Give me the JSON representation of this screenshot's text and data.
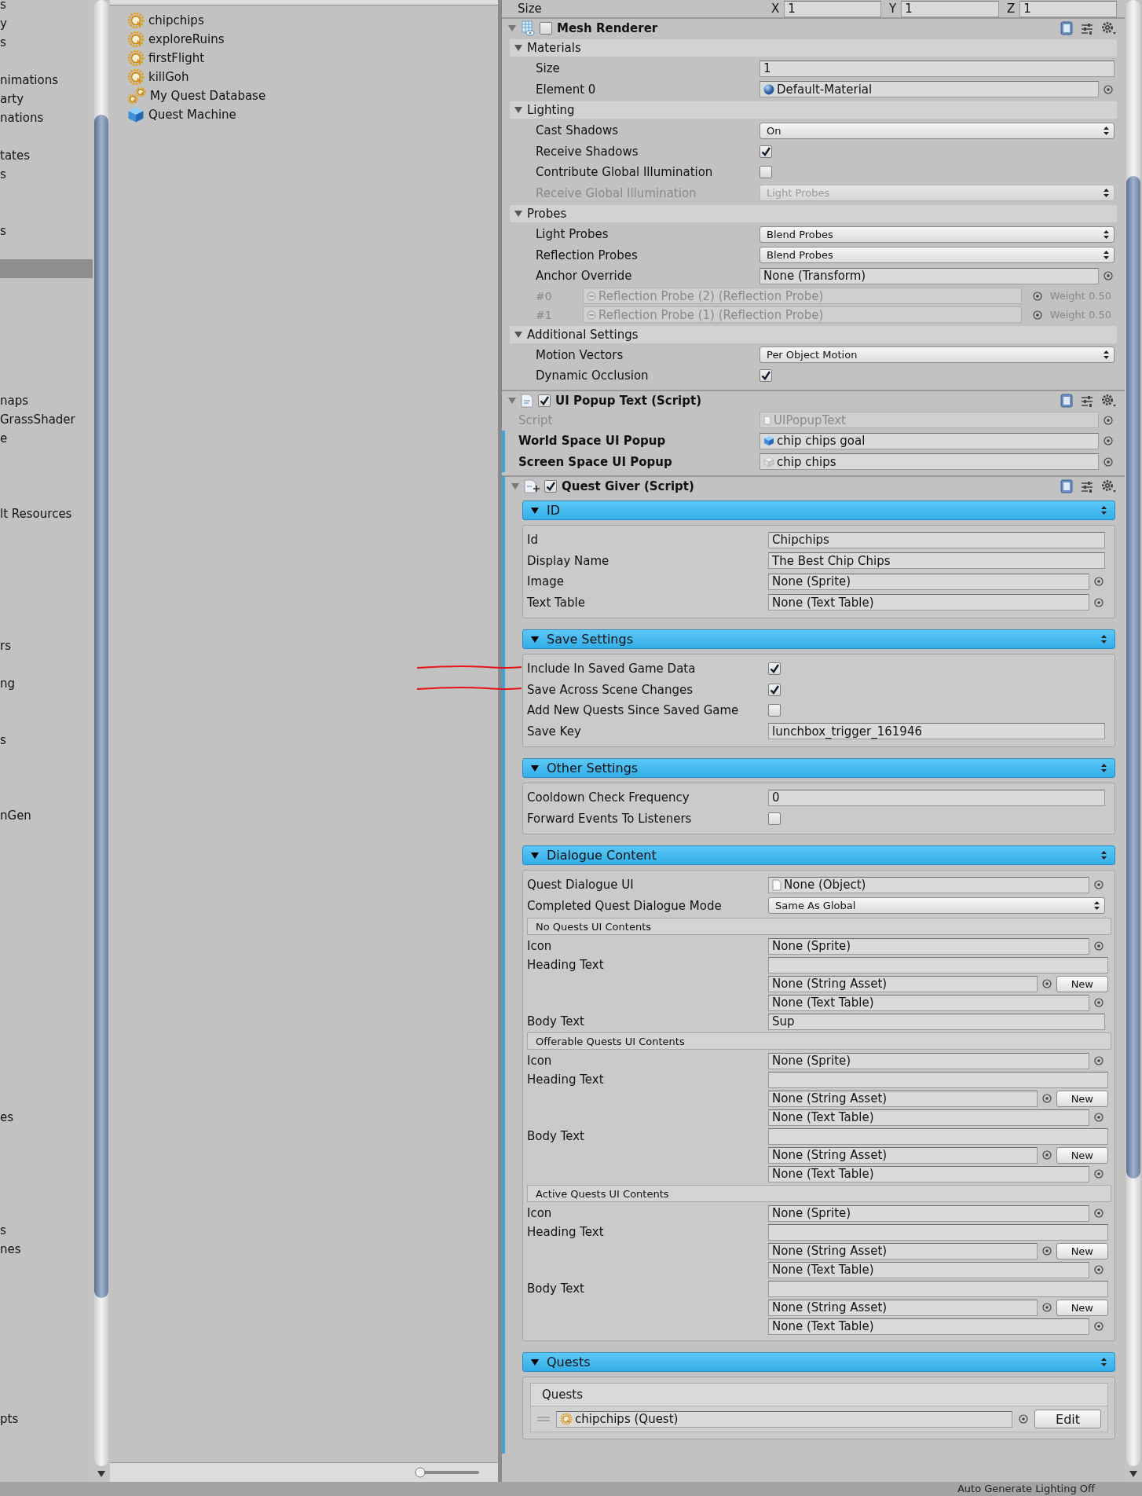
{
  "hierarchy": {
    "rows": [
      {
        "text": "s",
        "selected": false
      },
      {
        "text": "y",
        "selected": false
      },
      {
        "text": "s",
        "selected": false
      },
      {
        "selected": false
      },
      {
        "text": "nimations",
        "selected": false
      },
      {
        "text": "arty",
        "selected": false
      },
      {
        "text": "nations",
        "selected": false
      },
      {
        "selected": false
      },
      {
        "text": "tates",
        "selected": false
      },
      {
        "text": "s",
        "selected": false
      },
      {
        "selected": false
      },
      {
        "selected": false
      },
      {
        "text": "s",
        "selected": false
      },
      {
        "selected": false
      },
      {
        "selected": true
      },
      {
        "selected": false
      },
      {
        "selected": false
      },
      {
        "selected": false
      },
      {
        "selected": false
      },
      {
        "selected": false
      },
      {
        "selected": false
      },
      {
        "text": "naps",
        "selected": false
      },
      {
        "text": "GrassShader",
        "selected": false
      },
      {
        "text": "e",
        "selected": false
      },
      {
        "selected": false
      },
      {
        "selected": false
      },
      {
        "selected": false
      },
      {
        "text": "lt Resources",
        "selected": false
      },
      {
        "selected": false
      },
      {
        "selected": false
      },
      {
        "selected": false
      },
      {
        "selected": false
      },
      {
        "selected": false
      },
      {
        "selected": false
      },
      {
        "text": "rs",
        "selected": false
      },
      {
        "selected": false
      },
      {
        "text": "ng",
        "selected": false
      },
      {
        "selected": false
      },
      {
        "selected": false
      },
      {
        "text": "s",
        "selected": false
      },
      {
        "selected": false
      },
      {
        "selected": false
      },
      {
        "selected": false
      },
      {
        "text": "nGen",
        "selected": false
      },
      {
        "selected": false
      },
      {
        "selected": false
      },
      {
        "selected": false
      },
      {
        "selected": false
      },
      {
        "selected": false
      },
      {
        "selected": false
      },
      {
        "selected": false
      },
      {
        "selected": false
      },
      {
        "selected": false
      },
      {
        "selected": false
      },
      {
        "selected": false
      },
      {
        "selected": false
      },
      {
        "selected": false
      },
      {
        "selected": false
      },
      {
        "selected": false
      },
      {
        "text": "es",
        "selected": false
      },
      {
        "selected": false
      },
      {
        "selected": false
      },
      {
        "selected": false
      },
      {
        "selected": false
      },
      {
        "selected": false
      },
      {
        "text": "s",
        "selected": false
      },
      {
        "text": "nes",
        "selected": false
      },
      {
        "selected": false
      },
      {
        "selected": false
      },
      {
        "selected": false
      },
      {
        "selected": false
      },
      {
        "selected": false
      },
      {
        "selected": false
      },
      {
        "selected": false
      },
      {
        "selected": false
      },
      {
        "text": "pts",
        "selected": false
      }
    ]
  },
  "project": {
    "zoom_slider": {
      "level": 0
    },
    "items": [
      {
        "name": "chipchips",
        "kind": "quest"
      },
      {
        "name": "exploreRuins",
        "kind": "quest"
      },
      {
        "name": "firstFlight",
        "kind": "quest"
      },
      {
        "name": "killGoh",
        "kind": "quest"
      },
      {
        "name": "My Quest Database",
        "kind": "database"
      },
      {
        "name": "Quest Machine",
        "kind": "prefab"
      }
    ]
  },
  "inspector": {
    "transform_size": {
      "label": "Size",
      "axes": [
        {
          "label": "X",
          "value": "1"
        },
        {
          "label": "Y",
          "value": "1"
        },
        {
          "label": "Z",
          "value": "1"
        }
      ]
    },
    "components": [
      {
        "title": "Mesh Renderer",
        "kind": "mesh",
        "enabled": false,
        "expanded": true,
        "overridden": false,
        "rows": [
          {
            "kind": "group",
            "label": "Materials",
            "expanded": true
          },
          {
            "kind": "text",
            "label": "Size",
            "value": "1",
            "disabled": false
          },
          {
            "kind": "object",
            "label": "Element 0",
            "value": {
              "kind": "material",
              "text": "Default-Material"
            },
            "disabled": false
          },
          {
            "kind": "group",
            "label": "Lighting",
            "expanded": true
          },
          {
            "kind": "dropdown",
            "label": "Cast Shadows",
            "value": "On",
            "disabled": false
          },
          {
            "kind": "checkbox",
            "label": "Receive Shadows",
            "checked": true,
            "disabled": false
          },
          {
            "kind": "checkbox",
            "label": "Contribute Global Illumination",
            "checked": false,
            "disabled": false
          },
          {
            "kind": "dropdown",
            "label": "Receive Global Illumination",
            "value": "Light Probes",
            "disabled": true
          },
          {
            "kind": "group",
            "label": "Probes",
            "expanded": true
          },
          {
            "kind": "dropdown",
            "label": "Light Probes",
            "value": "Blend Probes",
            "disabled": false
          },
          {
            "kind": "dropdown",
            "label": "Reflection Probes",
            "value": "Blend Probes",
            "disabled": false
          },
          {
            "kind": "object",
            "label": "Anchor Override",
            "value": "None (Transform)",
            "disabled": false
          },
          {
            "kind": "probe",
            "label": "#0",
            "value": "Reflection Probe (2) (Reflection Probe)",
            "weight": "Weight 0.50",
            "disabled": true
          },
          {
            "kind": "probe",
            "label": "#1",
            "value": "Reflection Probe (1) (Reflection Probe)",
            "weight": "Weight 0.50",
            "disabled": true
          },
          {
            "kind": "group",
            "label": "Additional Settings",
            "expanded": true
          },
          {
            "kind": "dropdown",
            "label": "Motion Vectors",
            "value": "Per Object Motion",
            "disabled": false
          },
          {
            "kind": "checkbox",
            "label": "Dynamic Occlusion",
            "checked": true,
            "disabled": false
          }
        ]
      },
      {
        "title": "UI Popup Text (Script)",
        "kind": "script",
        "enabled": true,
        "expanded": true,
        "overridden": false,
        "rows": [
          {
            "kind": "object",
            "label": "Script",
            "value": {
              "kind": "script",
              "text": "UIPopupText"
            },
            "disabled": true,
            "overridden": false
          },
          {
            "kind": "object",
            "label": "World Space UI Popup",
            "value": {
              "kind": "prefab",
              "text": "chip chips goal"
            },
            "disabled": false,
            "overridden": true
          },
          {
            "kind": "object",
            "label": "Screen Space UI Popup",
            "value": {
              "kind": "prefab_empty",
              "text": "chip chips"
            },
            "disabled": false,
            "overridden": true
          }
        ]
      },
      {
        "title": "Quest Giver (Script)",
        "kind": "script_add",
        "enabled": true,
        "expanded": true,
        "overridden": true,
        "sections": [
          {
            "title": "ID",
            "expanded": true,
            "rows": [
              {
                "kind": "text",
                "label": "Id",
                "value": "Chipchips"
              },
              {
                "kind": "text",
                "label": "Display Name",
                "value": "The Best Chip Chips"
              },
              {
                "kind": "object",
                "label": "Image",
                "value": "None (Sprite)"
              },
              {
                "kind": "object",
                "label": "Text Table",
                "value": "None (Text Table)"
              }
            ]
          },
          {
            "title": "Save Settings",
            "expanded": true,
            "rows": [
              {
                "kind": "checkbox",
                "label": "Include In Saved Game Data",
                "checked": true,
                "marked": true
              },
              {
                "kind": "checkbox",
                "label": "Save Across Scene Changes",
                "checked": true,
                "marked": true
              },
              {
                "kind": "checkbox",
                "label": "Add New Quests Since Saved Game",
                "checked": false,
                "marked": false
              },
              {
                "kind": "text",
                "label": "Save Key",
                "value": "lunchbox_trigger_161946",
                "marked": false
              }
            ]
          },
          {
            "title": "Other Settings",
            "expanded": true,
            "rows": [
              {
                "kind": "text",
                "label": "Cooldown Check Frequency",
                "value": "0"
              },
              {
                "kind": "checkbox",
                "label": "Forward Events To Listeners",
                "checked": false
              }
            ]
          },
          {
            "title": "Dialogue Content",
            "expanded": true,
            "rows": [
              {
                "kind": "object",
                "label": "Quest Dialogue UI",
                "value": {
                  "kind": "object",
                  "text": "None (Object)"
                }
              },
              {
                "kind": "dropdown",
                "label": "Completed Quest Dialogue Mode",
                "value": "Same As Global"
              },
              {
                "kind": "subheader",
                "label": "No Quests UI Contents"
              },
              {
                "kind": "object",
                "label": "Icon",
                "value": "None (Sprite)"
              },
              {
                "kind": "localized",
                "label": "Heading Text",
                "asset": "None (String Asset)",
                "button": "New",
                "table": "None (Text Table)"
              },
              {
                "kind": "text",
                "label": "Body Text",
                "value": "Sup"
              },
              {
                "kind": "subheader",
                "label": "Offerable Quests UI Contents"
              },
              {
                "kind": "object",
                "label": "Icon",
                "value": "None (Sprite)"
              },
              {
                "kind": "localized",
                "label": "Heading Text",
                "asset": "None (String Asset)",
                "button": "New",
                "table": "None (Text Table)"
              },
              {
                "kind": "localized",
                "label": "Body Text",
                "asset": "None (String Asset)",
                "button": "New",
                "table": "None (Text Table)"
              },
              {
                "kind": "subheader",
                "label": "Active Quests UI Contents"
              },
              {
                "kind": "object",
                "label": "Icon",
                "value": "None (Sprite)"
              },
              {
                "kind": "localized",
                "label": "Heading Text",
                "asset": "None (String Asset)",
                "button": "New",
                "table": "None (Text Table)"
              },
              {
                "kind": "localized",
                "label": "Body Text",
                "asset": "None (String Asset)",
                "button": "New",
                "table": "None (Text Table)"
              }
            ]
          },
          {
            "title": "Quests",
            "expanded": true,
            "rows": [
              {
                "kind": "list",
                "label": "Quests",
                "items": [
                  {
                    "value": "chipchips (Quest)",
                    "button": "Edit"
                  }
                ]
              }
            ]
          }
        ]
      }
    ]
  },
  "status_bar": {
    "text": "Auto Generate Lighting Off"
  }
}
